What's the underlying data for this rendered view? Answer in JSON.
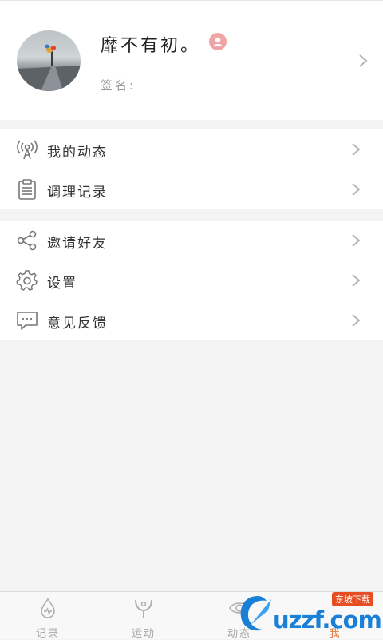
{
  "profile": {
    "nickname": "靡不有初。",
    "signature_label": "签名:"
  },
  "menu_group1": [
    {
      "label": "我的动态",
      "icon": "broadcast-icon"
    },
    {
      "label": "调理记录",
      "icon": "clipboard-icon"
    }
  ],
  "menu_group2": [
    {
      "label": "邀请好友",
      "icon": "share-icon"
    },
    {
      "label": "设置",
      "icon": "gear-icon"
    },
    {
      "label": "意见反馈",
      "icon": "feedback-icon"
    }
  ],
  "tabs": [
    {
      "label": "记录",
      "icon": "drop-icon",
      "active": false
    },
    {
      "label": "运动",
      "icon": "exercise-icon",
      "active": false
    },
    {
      "label": "动态",
      "icon": "eye-icon",
      "active": false
    },
    {
      "label": "我",
      "icon": "me-icon",
      "active": true
    }
  ],
  "colors": {
    "accent": "#e07a3c",
    "badge": "#f0a4a6",
    "background": "#f3f3f3"
  },
  "watermark": {
    "text": "uzzf.com",
    "tag": "东坡下载"
  }
}
